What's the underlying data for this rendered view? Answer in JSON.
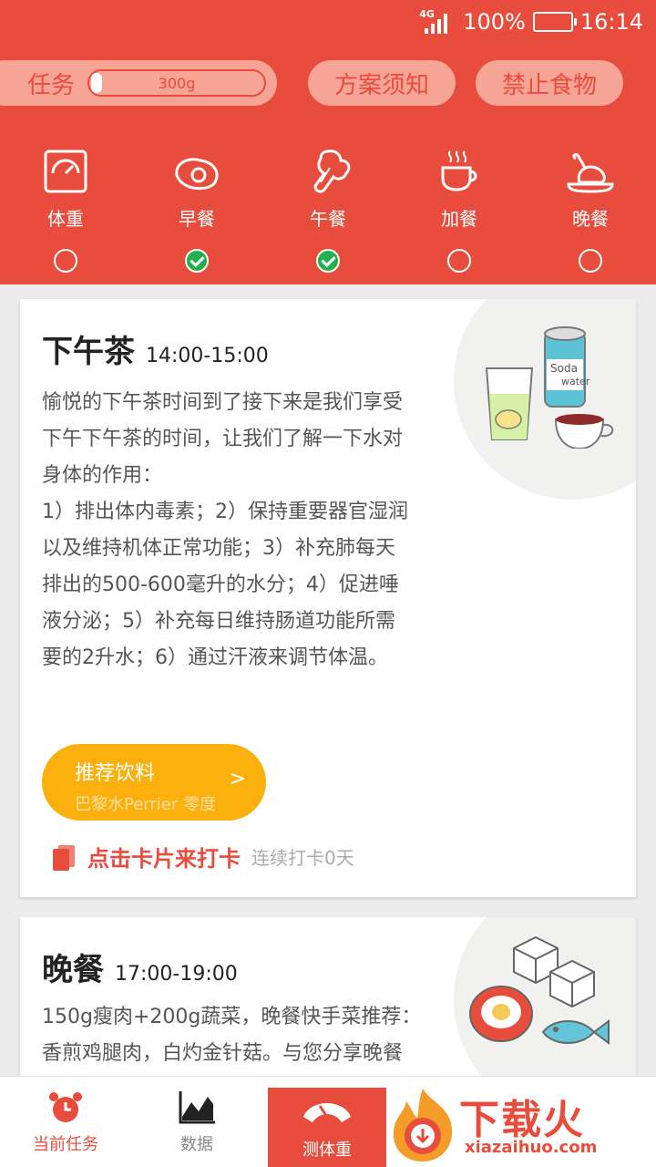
{
  "status_bar": {
    "network": "4G",
    "battery": "100%",
    "time": "16:14"
  },
  "top_bar": {
    "task_label": "任务",
    "task_progress_text": "300g",
    "task_progress_fraction": 0.04,
    "notice_label": "方案须知",
    "forbidden_label": "禁止食物"
  },
  "meal_tabs": [
    {
      "label": "体重",
      "icon": "scale-icon",
      "done": false
    },
    {
      "label": "早餐",
      "icon": "fried-egg-icon",
      "done": true
    },
    {
      "label": "午餐",
      "icon": "broccoli-icon",
      "done": true
    },
    {
      "label": "加餐",
      "icon": "coffee-cup-icon",
      "done": false
    },
    {
      "label": "晚餐",
      "icon": "roast-chicken-icon",
      "done": false
    }
  ],
  "cards": [
    {
      "title": "下午茶",
      "time": "14:00-15:00",
      "body_lines": [
        "愉悦的下午茶时间到了接下来是我们享受",
        "下午下午茶的时间，让我们了解一下水对",
        "身体的作用：",
        "1）排出体内毒素；2）保持重要器官湿润",
        "以及维持机体正常功能；3）补充肺每天",
        "排出的500-600毫升的水分；4）促进唾",
        "液分泌；5）补充每日维持肠道功能所需",
        "要的2升水；6）通过汗液来调节体温。"
      ],
      "illustration_text": [
        "Soda",
        "water"
      ],
      "drink_button": {
        "title": "推荐饮料",
        "subtitle": "巴黎水Perrier 零度",
        "arrow": ">"
      },
      "checkin": {
        "main": "点击卡片来打卡",
        "sub": "连续打卡0天"
      }
    },
    {
      "title": "晚餐",
      "time": "17:00-19:00",
      "body_lines": [
        "150g瘦肉+200g蔬菜，晚餐快手菜推荐：",
        "香煎鸡腿肉，白灼金针菇。与您分享晚餐"
      ]
    }
  ],
  "bottom_nav": [
    {
      "label": "当前任务",
      "icon": "alarm-clock-icon",
      "active": true
    },
    {
      "label": "数据",
      "icon": "chart-icon",
      "active": false
    },
    {
      "label": "测体重",
      "icon": "weighing-scale-icon",
      "active": false
    }
  ],
  "watermark": {
    "title": "下载火",
    "url": "xiazaihuo.com"
  },
  "colors": {
    "primary": "#e84c3d",
    "pill_bg": "#f5a496",
    "done_green": "#22b14c",
    "drink_button": "#fbb00e"
  }
}
